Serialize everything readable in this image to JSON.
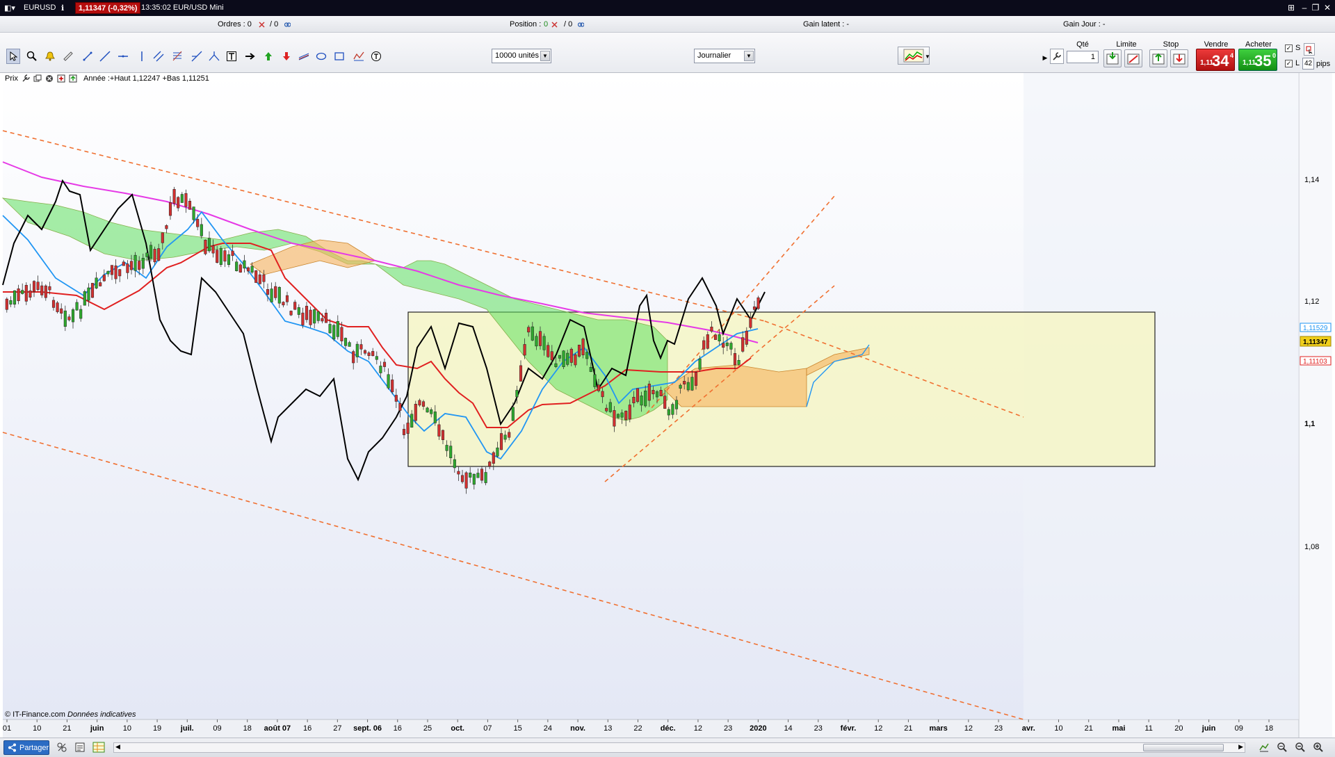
{
  "window": {
    "symbol": "EURUSD",
    "price_badge": "1,11347 (-0,32%)",
    "time_product": "13:35:02 EUR/USD Mini",
    "controls": [
      "⊞",
      "–",
      "❐",
      "✕"
    ]
  },
  "infobar": {
    "orders_label": "Ordres : 0",
    "orders_total": "/ 0",
    "position_label": "Position :",
    "position_value": "0",
    "position_total": "/ 0",
    "gain_latent": "Gain latent : -",
    "gain_jour": "Gain Jour : -"
  },
  "toolbar": {
    "units_value": "10000 unités",
    "period_value": "Journalier"
  },
  "trade": {
    "qty_label": "Qté",
    "qty_value": "1",
    "limit_label": "Limite",
    "stop_label": "Stop",
    "sell_label": "Vendre",
    "buy_label": "Acheter",
    "sell_prefix": "1,11",
    "sell_big": "34",
    "sell_sup": "4",
    "buy_prefix": "1,11",
    "buy_big": "35",
    "buy_sup": "0",
    "s_label": "S",
    "l_label": "L",
    "pips_value": "42",
    "pips_label": "pips"
  },
  "chart_header": {
    "prix_label": "Prix",
    "range_text": "Année :+Haut 1,12247 +Bas 1,11251"
  },
  "chart_data": {
    "type": "candlestick",
    "title": "",
    "y_ticks": [
      "1,14",
      "1,12",
      "1,1",
      "1,08"
    ],
    "x_ticks": [
      "01",
      "10",
      "21",
      "juin",
      "10",
      "19",
      "juil.",
      "09",
      "18",
      "août 07",
      "16",
      "27",
      "sept. 06",
      "16",
      "25",
      "oct.",
      "07",
      "15",
      "24",
      "nov.",
      "13",
      "22",
      "déc.",
      "12",
      "23",
      "2020",
      "14",
      "23",
      "févr.",
      "12",
      "21",
      "mars",
      "12",
      "23",
      "avr.",
      "10",
      "21",
      "mai",
      "11",
      "20",
      "juin",
      "09",
      "18"
    ],
    "price_labels": {
      "upper": "1,11529",
      "current": "1,11347",
      "lower": "1,11103"
    },
    "ylim": [
      1.06,
      1.155
    ]
  },
  "copyright": {
    "source": "© IT-Finance.com",
    "note": "Données indicatives"
  },
  "bottom": {
    "share_label": "Partager"
  }
}
